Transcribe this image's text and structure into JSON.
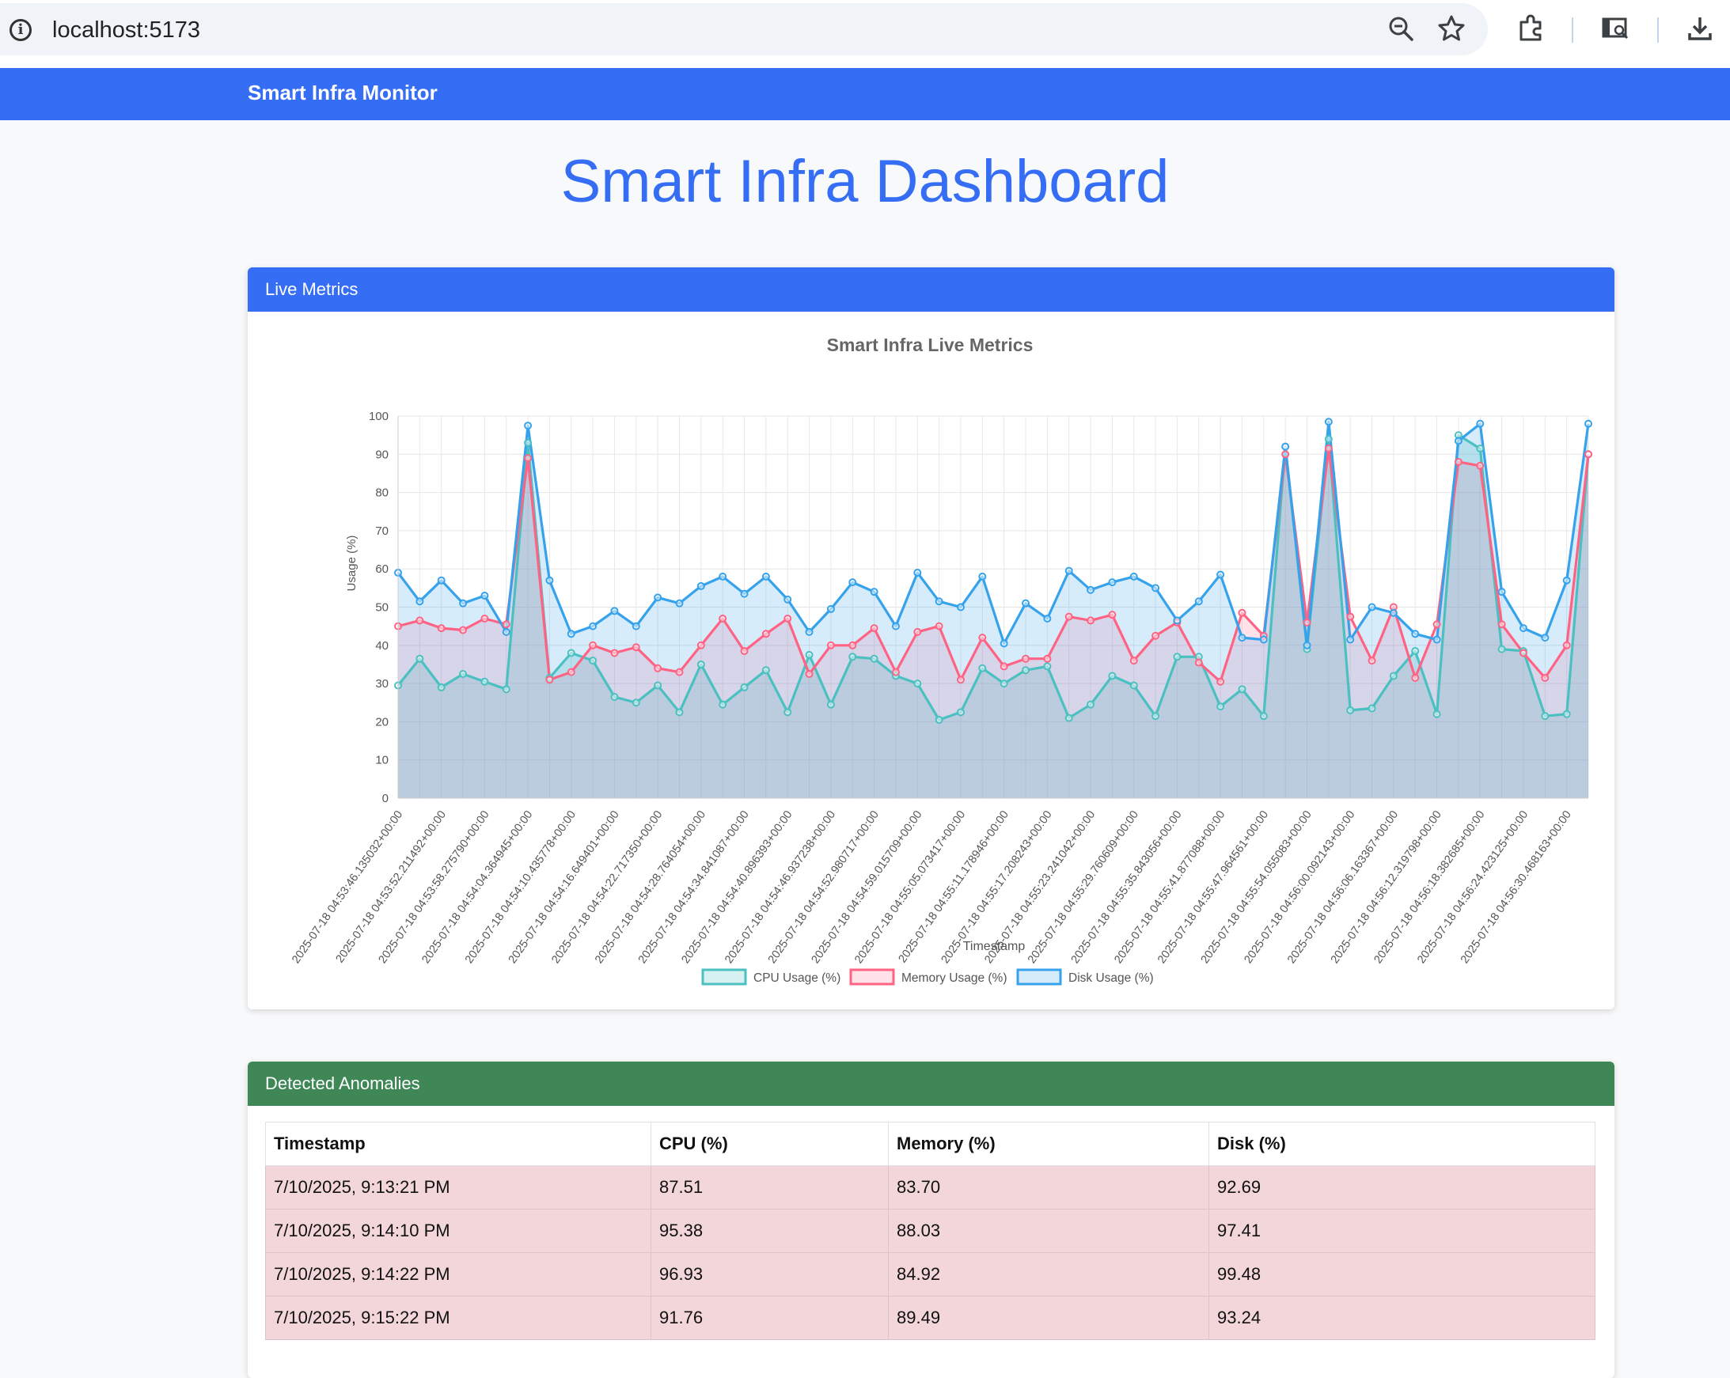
{
  "browser": {
    "url": "localhost:5173",
    "icons": [
      "info-icon",
      "zoom-out-icon",
      "star-icon",
      "extensions-icon",
      "screen-search-icon",
      "download-icon"
    ]
  },
  "navbar": {
    "brand": "Smart Infra Monitor"
  },
  "page": {
    "title": "Smart Infra Dashboard"
  },
  "metrics_card": {
    "title": "Live Metrics"
  },
  "anomalies_card": {
    "title": "Detected Anomalies",
    "columns": [
      "Timestamp",
      "CPU (%)",
      "Memory (%)",
      "Disk (%)"
    ],
    "rows": [
      [
        "7/10/2025, 9:13:21 PM",
        "87.51",
        "83.70",
        "92.69"
      ],
      [
        "7/10/2025, 9:14:10 PM",
        "95.38",
        "88.03",
        "97.41"
      ],
      [
        "7/10/2025, 9:14:22 PM",
        "96.93",
        "84.92",
        "99.48"
      ],
      [
        "7/10/2025, 9:15:22 PM",
        "91.76",
        "89.49",
        "93.24"
      ]
    ]
  },
  "colors": {
    "navbar": "#356ef5",
    "anomaly_header": "#3f8756",
    "cpu": "#4bc0c0",
    "memory": "#ff6384",
    "disk": "#36a2eb",
    "anomaly_row": "#f3d6d9"
  },
  "chart_data": {
    "type": "line",
    "title": "Smart Infra Live Metrics",
    "xlabel": "Timestamp",
    "ylabel": "Usage (%)",
    "ylim": [
      0,
      100
    ],
    "yticks": [
      0,
      10,
      20,
      30,
      40,
      50,
      60,
      70,
      80,
      90,
      100
    ],
    "grid": true,
    "legend_position": "bottom",
    "x_tick_labels": [
      "2025-07-18 04:53:46.135032+00:00",
      "2025-07-18 04:53:52.211492+00:00",
      "2025-07-18 04:53:58.275790+00:00",
      "2025-07-18 04:54:04.364945+00:00",
      "2025-07-18 04:54:10.435778+00:00",
      "2025-07-18 04:54:16.649401+00:00",
      "2025-07-18 04:54:22.717350+00:00",
      "2025-07-18 04:54:28.764054+00:00",
      "2025-07-18 04:54:34.841087+00:00",
      "2025-07-18 04:54:40.896393+00:00",
      "2025-07-18 04:54:46.937238+00:00",
      "2025-07-18 04:54:52.980717+00:00",
      "2025-07-18 04:54:59.015709+00:00",
      "2025-07-18 04:55:05.073417+00:00",
      "2025-07-18 04:55:11.178946+00:00",
      "2025-07-18 04:55:17.208243+00:00",
      "2025-07-18 04:55:23.241042+00:00",
      "2025-07-18 04:55:29.760609+00:00",
      "2025-07-18 04:55:35.843056+00:00",
      "2025-07-18 04:55:41.877088+00:00",
      "2025-07-18 04:55:47.964561+00:00",
      "2025-07-18 04:55:54.055083+00:00",
      "2025-07-18 04:56:00.092143+00:00",
      "2025-07-18 04:56:06.163367+00:00",
      "2025-07-18 04:56:12.319798+00:00",
      "2025-07-18 04:56:18.382685+00:00",
      "2025-07-18 04:56:24.423125+00:00",
      "2025-07-18 04:56:30.468163+00:00"
    ],
    "series": [
      {
        "name": "CPU Usage (%)",
        "values": [
          29.5,
          36.5,
          29.0,
          32.5,
          30.5,
          28.5,
          93.0,
          31.5,
          38.0,
          36.0,
          26.5,
          25.0,
          29.5,
          22.5,
          35.0,
          24.5,
          29.0,
          33.5,
          22.5,
          37.5,
          24.5,
          37.0,
          36.5,
          32.0,
          30.0,
          20.5,
          22.5,
          34.0,
          30.0,
          33.5,
          34.5,
          21.0,
          24.5,
          32.0,
          29.5,
          21.5,
          37.0,
          37.0,
          24.0,
          28.5,
          21.5,
          92.0,
          39.0,
          94.0,
          23.0,
          23.5,
          32.0,
          38.5,
          22.0,
          95.0,
          91.5,
          39.0,
          38.5,
          21.5,
          22.0,
          90.0
        ]
      },
      {
        "name": "Memory Usage (%)",
        "values": [
          45.0,
          46.5,
          44.5,
          44.0,
          47.0,
          45.5,
          89.0,
          31.0,
          33.0,
          40.0,
          38.0,
          39.5,
          34.0,
          33.0,
          40.0,
          47.0,
          38.5,
          43.0,
          47.0,
          32.5,
          40.0,
          40.0,
          44.5,
          33.0,
          43.5,
          45.0,
          31.0,
          42.0,
          34.5,
          36.5,
          36.5,
          47.5,
          46.5,
          48.0,
          36.0,
          42.5,
          46.0,
          35.5,
          30.5,
          48.5,
          42.5,
          90.0,
          46.0,
          91.5,
          47.5,
          36.0,
          50.0,
          31.5,
          45.5,
          88.0,
          87.0,
          45.5,
          38.0,
          31.5,
          40.0,
          90.0
        ]
      },
      {
        "name": "Disk Usage (%)",
        "values": [
          59.0,
          51.5,
          57.0,
          51.0,
          53.0,
          43.5,
          97.5,
          57.0,
          43.0,
          45.0,
          49.0,
          45.0,
          52.5,
          51.0,
          55.5,
          58.0,
          53.5,
          58.0,
          52.0,
          43.5,
          49.5,
          56.5,
          54.0,
          45.0,
          59.0,
          51.5,
          50.0,
          58.0,
          40.5,
          51.0,
          47.0,
          59.5,
          54.5,
          56.5,
          58.0,
          55.0,
          46.5,
          51.5,
          58.5,
          42.0,
          41.5,
          92.0,
          40.0,
          98.5,
          41.5,
          50.0,
          48.5,
          43.0,
          41.5,
          93.5,
          98.0,
          54.0,
          44.5,
          42.0,
          57.0,
          98.0
        ]
      }
    ]
  }
}
